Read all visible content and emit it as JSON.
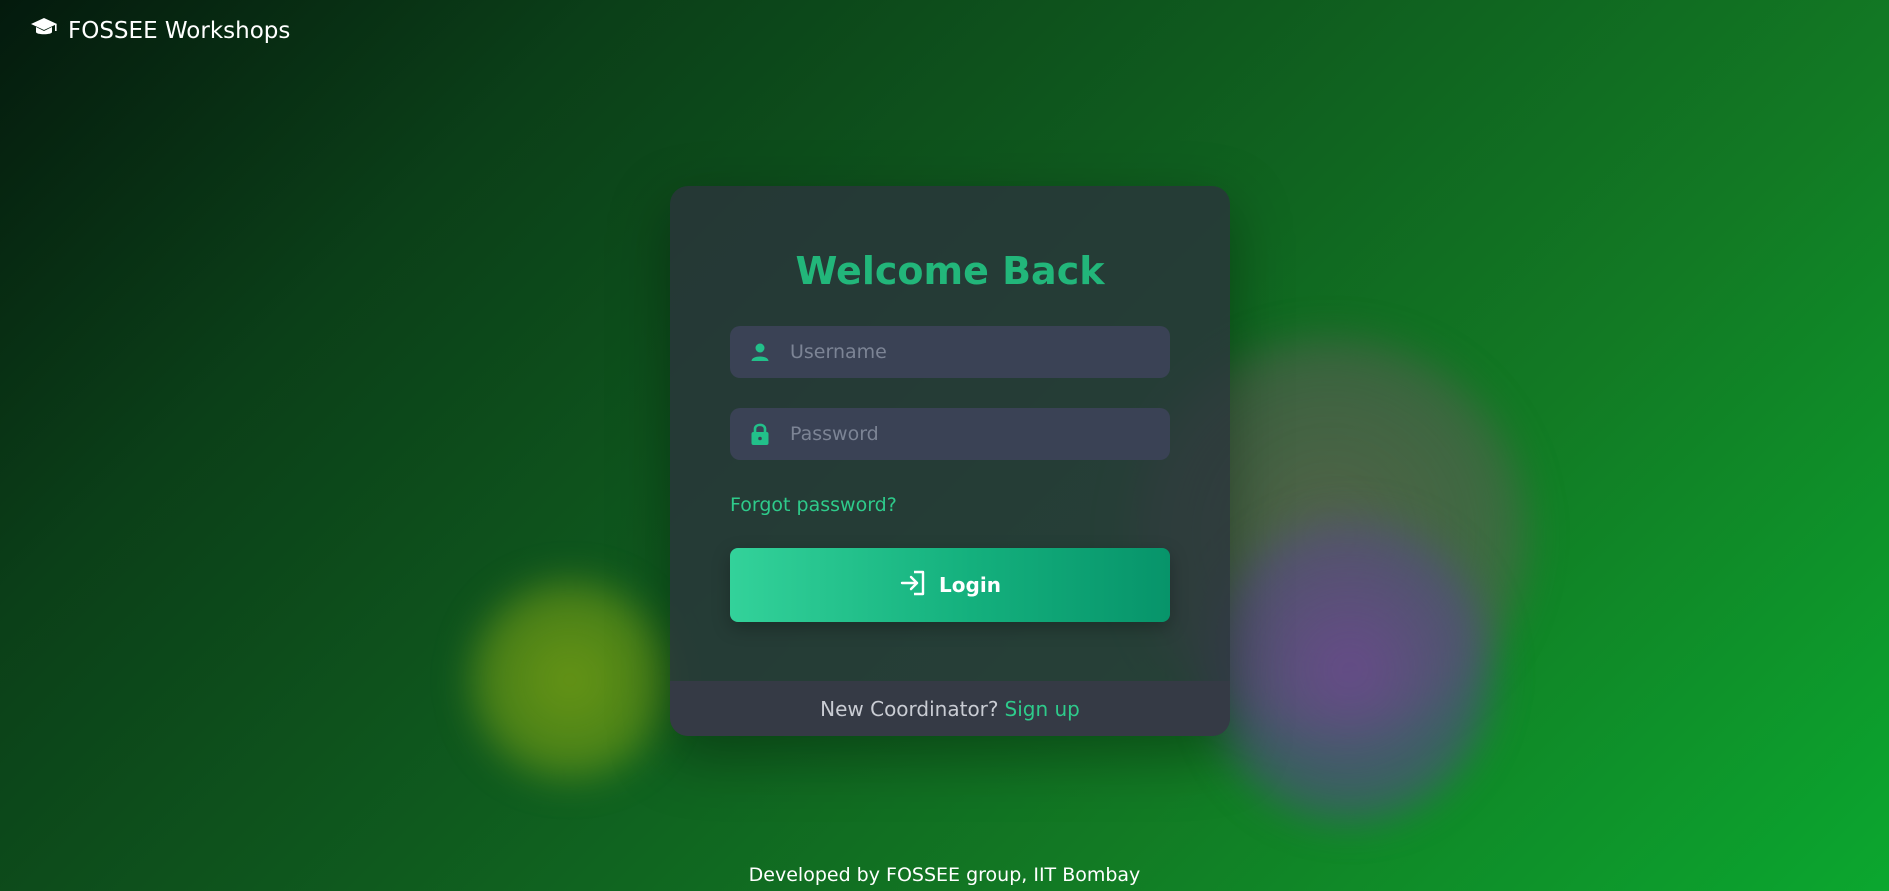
{
  "brand": {
    "name": "FOSSEE Workshops",
    "icon": "graduation-cap-icon"
  },
  "login": {
    "title": "Welcome Back",
    "username": {
      "placeholder": "Username",
      "value": "",
      "icon": "user-icon"
    },
    "password": {
      "placeholder": "Password",
      "value": "",
      "icon": "lock-icon"
    },
    "forgot_label": "Forgot password?",
    "submit_label": "Login",
    "submit_icon": "sign-in-icon"
  },
  "signup": {
    "prompt": "New Coordinator?",
    "link_label": "Sign up"
  },
  "footer": {
    "text": "Developed by FOSSEE group, IIT Bombay"
  },
  "colors": {
    "accent": "#22b67a",
    "link": "#2ecb8b",
    "field_bg": "#3a4255",
    "card_bg": "#2b343c"
  }
}
